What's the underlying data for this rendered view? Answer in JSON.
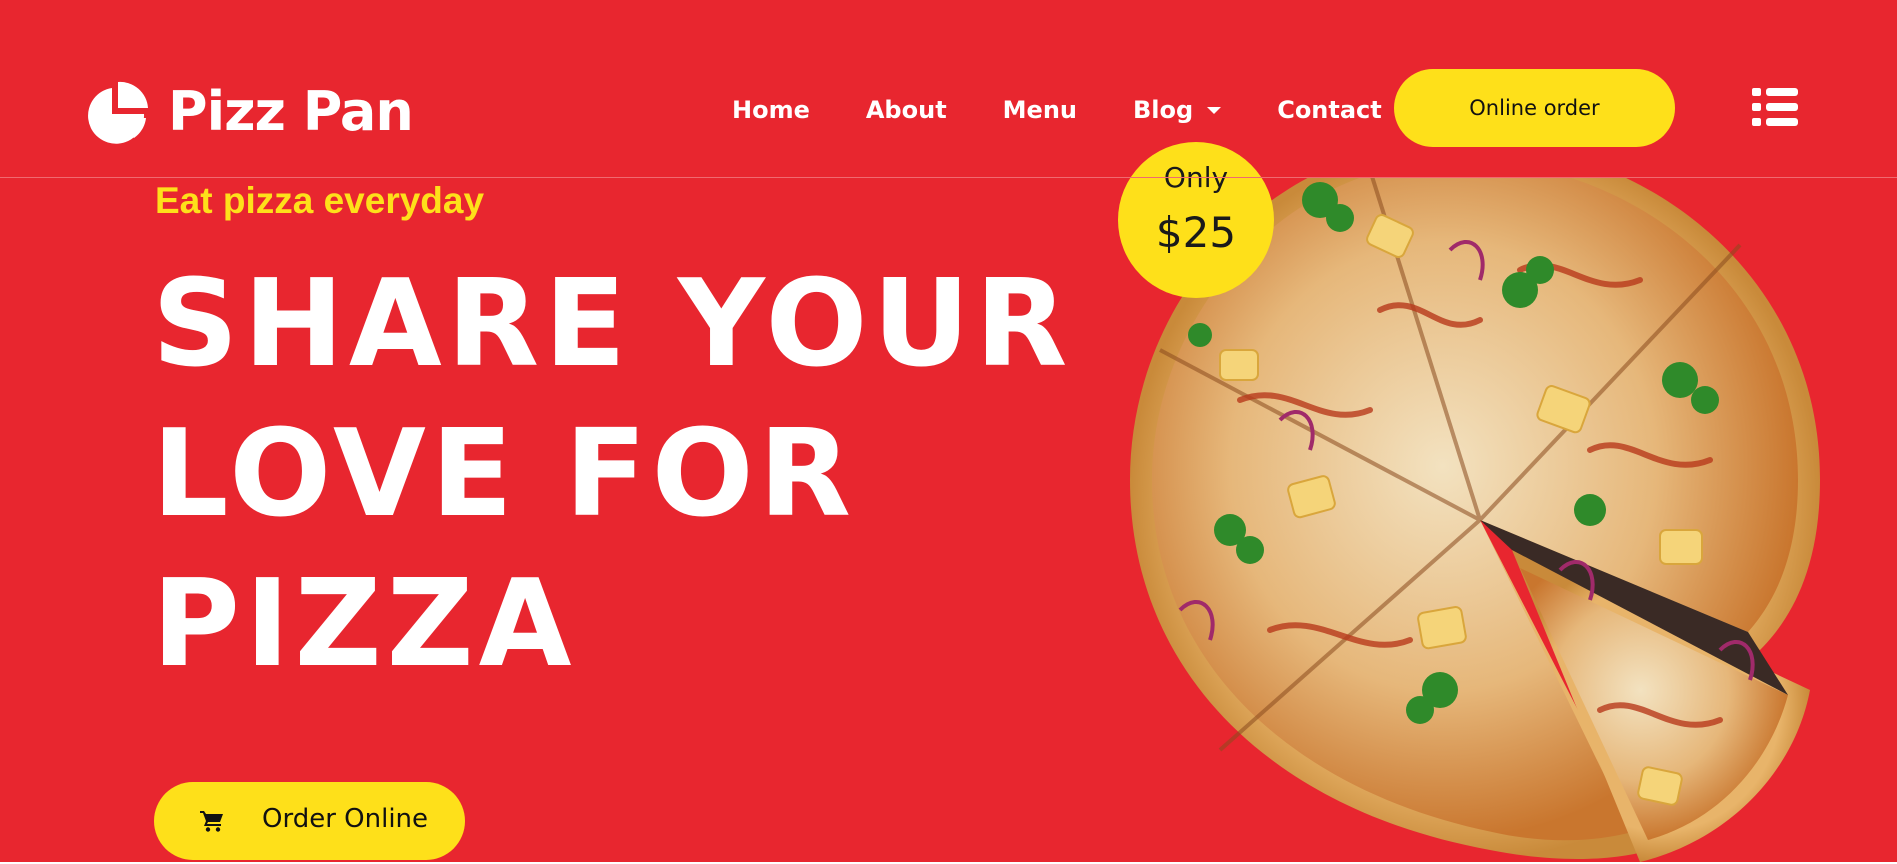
{
  "brand": {
    "name": "Pizz Pan",
    "logo_icon": "pie-logo-icon"
  },
  "nav": {
    "items": [
      {
        "label": "Home"
      },
      {
        "label": "About"
      },
      {
        "label": "Menu"
      },
      {
        "label": "Blog",
        "has_dropdown": true
      },
      {
        "label": "Contact"
      }
    ],
    "order_button": "Online order",
    "menu_icon": "list-menu-icon"
  },
  "hero": {
    "tagline": "Eat pizza everyday",
    "headline_lines": [
      "SHARE YOUR",
      "LOVE FOR",
      "PIZZA"
    ],
    "cta_label": "Order Online",
    "cta_icon": "cart-icon"
  },
  "badge": {
    "only": "Only",
    "price": "$25"
  },
  "colors": {
    "background": "#e8262f",
    "accent": "#fee01a",
    "text": "#ffffff",
    "dark_text": "#111111"
  }
}
